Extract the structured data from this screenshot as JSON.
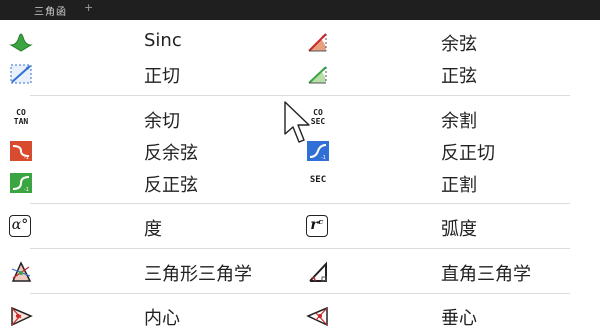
{
  "window": {
    "title": "三角函",
    "plus": "+"
  },
  "items": [
    {
      "label": "Sinc",
      "icon": "sinc-icon"
    },
    {
      "label": "余弦",
      "icon": "cosine-icon"
    },
    {
      "label": "正切",
      "icon": "tangent-icon"
    },
    {
      "label": "正弦",
      "icon": "sine-icon"
    },
    {
      "label": "余切",
      "icon": "cotangent-icon",
      "icon_text": [
        "CO",
        "TAN"
      ]
    },
    {
      "label": "余割",
      "icon": "cosecant-icon",
      "icon_text": [
        "CO",
        "SEC"
      ]
    },
    {
      "label": "反余弦",
      "icon": "arccosine-icon"
    },
    {
      "label": "反正切",
      "icon": "arctangent-icon"
    },
    {
      "label": "反正弦",
      "icon": "arcsine-icon"
    },
    {
      "label": "正割",
      "icon": "secant-icon",
      "icon_text": [
        "SEC"
      ]
    },
    {
      "label": "度",
      "icon": "degree-icon",
      "icon_text": [
        "α°"
      ]
    },
    {
      "label": "弧度",
      "icon": "radian-icon",
      "icon_text": [
        "rᶜ"
      ]
    },
    {
      "label": "三角形三角学",
      "icon": "triangle-trig-icon"
    },
    {
      "label": "直角三角学",
      "icon": "right-triangle-trig-icon"
    },
    {
      "label": "内心",
      "icon": "incenter-icon"
    },
    {
      "label": "垂心",
      "icon": "orthocenter-icon"
    }
  ],
  "colors": {
    "titlebar": "#1f1f1f",
    "separator": "#dcdcdc",
    "icon_blue": "#2f6fd6",
    "icon_green": "#3aa541",
    "icon_red": "#d84b2f"
  }
}
